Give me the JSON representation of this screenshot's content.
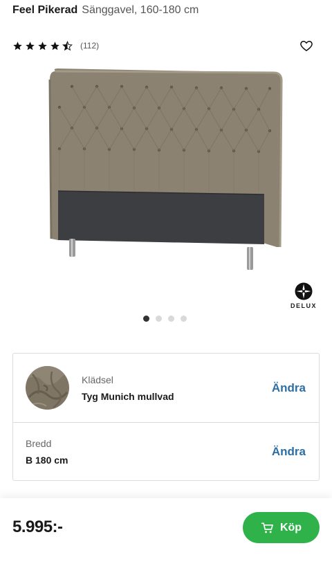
{
  "product": {
    "brand": "Feel Pikerad",
    "subtitle": "Sänggavel, 160-180 cm",
    "rating": 4.5,
    "rating_count": "(112)"
  },
  "images": {
    "logo_text": "DELUX",
    "dots_total": 4,
    "active_dot": 1
  },
  "options": [
    {
      "label": "Klädsel",
      "value": "Tyg Munich mullvad",
      "action": "Ändra"
    },
    {
      "label": "Bredd",
      "value": "B 180 cm",
      "action": "Ändra"
    }
  ],
  "footer": {
    "price": "5.995:-",
    "buy_label": "Köp"
  },
  "colors": {
    "accent_green": "#2fb24a",
    "link_blue": "#2b6fa6",
    "fabric": "#8b8272",
    "panel": "#3d3e41"
  }
}
